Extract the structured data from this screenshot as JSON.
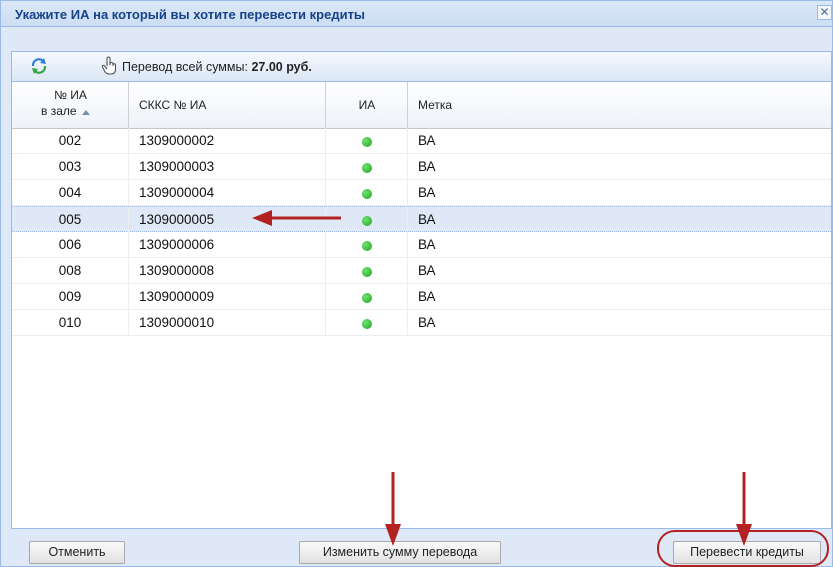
{
  "dialog": {
    "title": "Укажите ИА на который вы хотите перевести кредиты",
    "close_label": "✕"
  },
  "toolbar": {
    "refresh_icon": "refresh-icon",
    "hand_icon": "hand-pointer-icon",
    "transfer_label": "Перевод всей суммы:",
    "transfer_amount": "27.00 руб."
  },
  "table": {
    "columns": [
      {
        "line1": "№ ИА",
        "line2": "в зале",
        "sort": "asc"
      },
      {
        "label": "СККС № ИА"
      },
      {
        "label": "ИА"
      },
      {
        "label": "Метка"
      }
    ],
    "rows": [
      {
        "num": "002",
        "skks": "1309000002",
        "status": "online",
        "label": "ВА"
      },
      {
        "num": "003",
        "skks": "1309000003",
        "status": "online",
        "label": "ВА"
      },
      {
        "num": "004",
        "skks": "1309000004",
        "status": "online",
        "label": "ВА"
      },
      {
        "num": "005",
        "skks": "1309000005",
        "status": "online",
        "label": "ВА",
        "selected": true
      },
      {
        "num": "006",
        "skks": "1309000006",
        "status": "online",
        "label": "ВА"
      },
      {
        "num": "008",
        "skks": "1309000008",
        "status": "online",
        "label": "ВА"
      },
      {
        "num": "009",
        "skks": "1309000009",
        "status": "online",
        "label": "ВА"
      },
      {
        "num": "010",
        "skks": "1309000010",
        "status": "online",
        "label": "ВА"
      }
    ]
  },
  "footer": {
    "cancel_label": "Отменить",
    "change_amount_label": "Изменить сумму перевода",
    "transfer_label": "Перевести кредиты"
  },
  "colors": {
    "accent": "#15428b",
    "status_online": "#1ea31e",
    "annotation": "#b22222"
  }
}
